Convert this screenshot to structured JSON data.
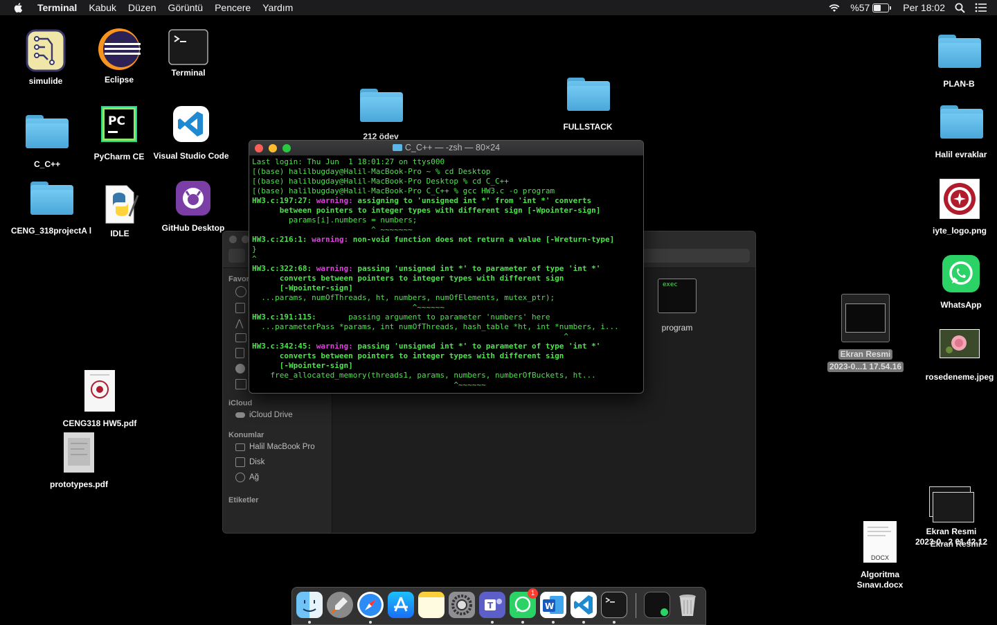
{
  "menubar": {
    "app_name": "Terminal",
    "items": [
      "Kabuk",
      "Düzen",
      "Görüntü",
      "Pencere",
      "Yardım"
    ],
    "battery": "%57",
    "clock": "Per 18:02"
  },
  "desktop": {
    "simulide": "simulide",
    "eclipse": "Eclipse",
    "terminal": "Terminal",
    "c_cpp": "C_C++",
    "pycharm": "PyCharm CE",
    "vscode": "Visual Studio Code",
    "ceng318project": "CENG_318projectA l",
    "idle": "IDLE",
    "github_desktop": "GitHub Desktop",
    "odev": "212 ödev",
    "fullstack": "FULLSTACK",
    "plan_b": "PLAN-B",
    "halil_evraklar": "Halil evraklar",
    "iyte_logo": "iyte_logo.png",
    "whatsapp": "WhatsApp",
    "ekran_resmi_1_line1": "Ekran Resmi",
    "ekran_resmi_1_line2": "2023-0...1 17.54.16",
    "rosedeneme": "rosedeneme.jpeg",
    "ceng318_hw5": "CENG318 HW5.pdf",
    "prototypes": "prototypes.pdf",
    "algoritma_line1": "Algoritma",
    "algoritma_line2": "Sınavı.docx",
    "docx_badge": "DOCX",
    "ekran_resmi_stack_line1": "Ekran Resmi",
    "ekran_resmi_stack_line2": "2023-0...2 01.42.12",
    "ekran_resmi_stack_overlap": "Ekran Resmi"
  },
  "terminal_window": {
    "title": "C_C++ — -zsh — 80×24",
    "lines": [
      {
        "parts": [
          {
            "t": "Last login: Thu Jun  1 18:01:27 on ttys000",
            "c": "plain"
          }
        ]
      },
      {
        "parts": [
          {
            "t": "[(base) halilbugday@Halil-MacBook-Pro ~ % cd Desktop",
            "c": "plain"
          }
        ]
      },
      {
        "parts": [
          {
            "t": "[(base) halilbugday@Halil-MacBook-Pro Desktop % cd C_C++",
            "c": "plain"
          }
        ]
      },
      {
        "parts": [
          {
            "t": "[(base) halilbugday@Halil-MacBook-Pro C_C++ % gcc HW3.c -o program",
            "c": "plain"
          }
        ]
      },
      {
        "parts": [
          {
            "t": "HW3.c:197:27: ",
            "c": "b"
          },
          {
            "t": "warning: ",
            "c": "mag"
          },
          {
            "t": "assigning to 'unsigned int *' from 'int *' converts",
            "c": "b"
          }
        ]
      },
      {
        "parts": [
          {
            "t": "      between pointers to integer types with different sign [-Wpointer-sign]",
            "c": "b"
          }
        ]
      },
      {
        "parts": [
          {
            "t": "        params[i].numbers = numbers;",
            "c": "plain"
          }
        ]
      },
      {
        "parts": [
          {
            "t": "                          ^ ~~~~~~~",
            "c": "plain"
          }
        ]
      },
      {
        "parts": [
          {
            "t": "HW3.c:216:1: ",
            "c": "b"
          },
          {
            "t": "warning: ",
            "c": "mag"
          },
          {
            "t": "non-void function does not return a value [-Wreturn-type]",
            "c": "b"
          }
        ]
      },
      {
        "parts": [
          {
            "t": "}",
            "c": "plain"
          }
        ]
      },
      {
        "parts": [
          {
            "t": "^",
            "c": "plain"
          }
        ]
      },
      {
        "parts": [
          {
            "t": "HW3.c:322:68: ",
            "c": "b"
          },
          {
            "t": "warning: ",
            "c": "mag"
          },
          {
            "t": "passing 'unsigned int *' to parameter of type 'int *'",
            "c": "b"
          }
        ]
      },
      {
        "parts": [
          {
            "t": "      converts between pointers to integer types with different sign",
            "c": "b"
          }
        ]
      },
      {
        "parts": [
          {
            "t": "      [-Wpointer-sign]",
            "c": "b"
          }
        ]
      },
      {
        "parts": [
          {
            "t": "  ...params, numOfThreads, ht, numbers, numOfElements, mutex_ptr);",
            "c": "plain"
          }
        ]
      },
      {
        "parts": [
          {
            "t": "                                   ^~~~~~~",
            "c": "plain"
          }
        ]
      },
      {
        "parts": [
          {
            "t": "HW3.c:191:115:       ",
            "c": "b"
          },
          {
            "t": "passing argument to parameter 'numbers' here",
            "c": "plain"
          }
        ]
      },
      {
        "parts": [
          {
            "t": "  ...parameterPass *params, int numOfThreads, hash_table *ht, int *numbers, i...",
            "c": "plain"
          }
        ]
      },
      {
        "parts": [
          {
            "t": "                                                                    ^",
            "c": "plain"
          }
        ]
      },
      {
        "parts": [
          {
            "t": "HW3.c:342:45: ",
            "c": "b"
          },
          {
            "t": "warning: ",
            "c": "mag"
          },
          {
            "t": "passing 'unsigned int *' to parameter of type 'int *'",
            "c": "b"
          }
        ]
      },
      {
        "parts": [
          {
            "t": "      converts between pointers to integer types with different sign",
            "c": "b"
          }
        ]
      },
      {
        "parts": [
          {
            "t": "      [-Wpointer-sign]",
            "c": "b"
          }
        ]
      },
      {
        "parts": [
          {
            "t": "    free_allocated_memory(threads1, params, numbers, numberOfBuckets, ht...",
            "c": "plain"
          }
        ]
      },
      {
        "parts": [
          {
            "t": "                                            ^~~~~~~",
            "c": "plain"
          }
        ]
      }
    ]
  },
  "finder_window": {
    "favorites_header": "Favor",
    "icloud_header": "iCloud",
    "icloud_drive": "iCloud Drive",
    "locations_header": "Konumlar",
    "macbook": "Halil MacBook Pro",
    "disk": "Disk",
    "network": "Ağ",
    "tags_header": "Etiketler",
    "file_program": "program",
    "exec_badge": "exec"
  },
  "dock": {
    "whatsapp_badge": "1"
  },
  "colors": {
    "terminal_green": "#4fe24f",
    "terminal_warning": "#e040e0",
    "folder_blue": "#5ab6e6"
  }
}
